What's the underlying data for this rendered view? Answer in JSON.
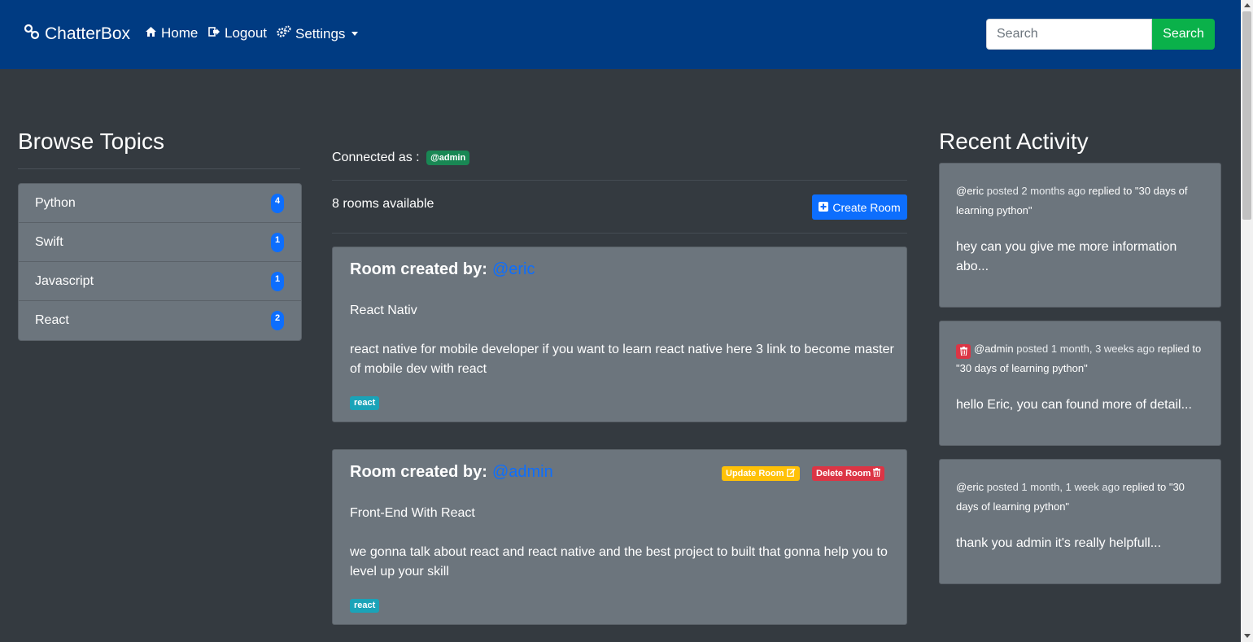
{
  "navbar": {
    "brand": "ChatterBox",
    "home": "Home",
    "logout": "Logout",
    "settings": "Settings",
    "search_placeholder": "Search",
    "search_button": "Search"
  },
  "topics": {
    "title": "Browse Topics",
    "items": [
      {
        "name": "Python",
        "count": "4"
      },
      {
        "name": "Swift",
        "count": "1"
      },
      {
        "name": "Javascript",
        "count": "1"
      },
      {
        "name": "React",
        "count": "2"
      }
    ]
  },
  "main": {
    "connected_label": "Connected as :",
    "connected_user": "@admin",
    "rooms_available": "8 rooms available",
    "create_room": "Create Room",
    "room_created_by": "Room created by:",
    "rooms": [
      {
        "author": "@eric",
        "name": "React Nativ",
        "description": "react native for mobile developer if you want to learn react native here 3 link to become master of mobile dev with react",
        "tag": "react"
      },
      {
        "author": "@admin",
        "name": "Front-End With React",
        "description": "we gonna talk about react and react native and the best project to built that gonna help you to level up your skill",
        "tag": "react",
        "update_label": "Update Room",
        "delete_label": "Delete Room"
      }
    ]
  },
  "activity": {
    "title": "Recent Activity",
    "items": [
      {
        "user": "@eric",
        "time": "posted 2 months ago",
        "action": "replied to \"30 days of learning python\"",
        "body": "hey can you give me more information abo..."
      },
      {
        "user": "@admin",
        "time": "posted 1 month, 3 weeks ago",
        "action": "replied to \"30 days of learning python\"",
        "body": "hello Eric, you can found more of detail..."
      },
      {
        "user": "@eric",
        "time": "posted 1 month, 1 week ago",
        "action": "replied to \"30 days of learning python\"",
        "body": "thank you admin it's really helpfull..."
      }
    ]
  },
  "colors": {
    "navbar": "#003b82",
    "background": "#343a40",
    "card": "#6c757d",
    "primary": "#0d6efd",
    "success": "#0ab14a",
    "warning": "#ffc107",
    "danger": "#dc3545",
    "info": "#1aa3b8"
  }
}
